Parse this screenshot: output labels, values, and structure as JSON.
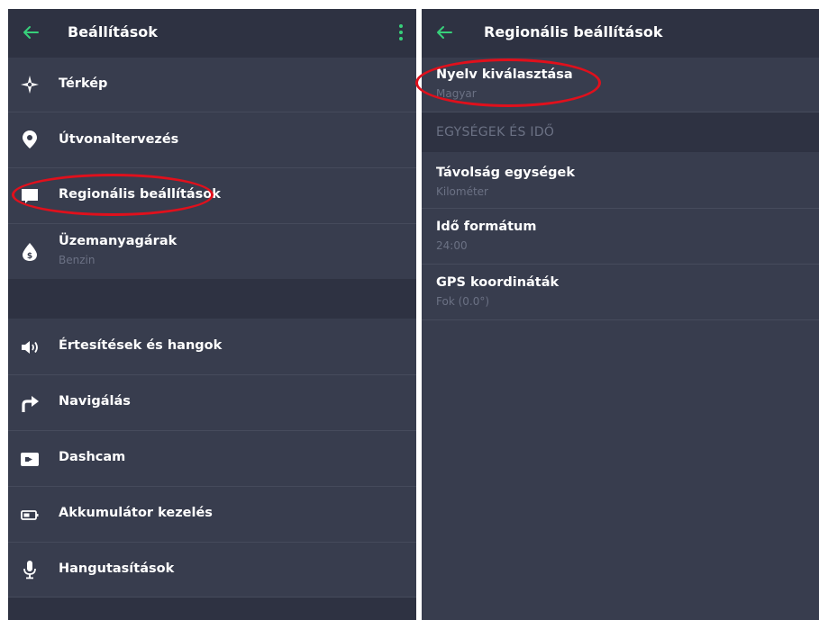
{
  "colors": {
    "accent": "#37d07a",
    "panel_bg": "#383d4e",
    "header_bg": "#2e3242",
    "highlight": "#e0101c"
  },
  "left": {
    "title": "Beállítások",
    "back_icon": "back-arrow-icon",
    "menu_icon": "more-vertical-icon",
    "items": [
      {
        "label": "Térkép",
        "icon": "compass-icon"
      },
      {
        "label": "Útvonaltervezés",
        "icon": "map-pin-icon"
      },
      {
        "label": "Regionális beállítások",
        "icon": "flag-icon"
      },
      {
        "label": "Üzemanyagárak",
        "sublabel": "Benzin",
        "icon": "fuel-drop-icon"
      },
      {
        "label": "Értesítések és hangok",
        "icon": "speaker-icon"
      },
      {
        "label": "Navigálás",
        "icon": "turn-right-icon"
      },
      {
        "label": "Dashcam",
        "icon": "camera-icon"
      },
      {
        "label": "Akkumulátor kezelés",
        "icon": "battery-icon"
      },
      {
        "label": "Hangutasítások",
        "icon": "microphone-icon"
      }
    ]
  },
  "right": {
    "title": "Regionális beállítások",
    "back_icon": "back-arrow-icon",
    "language": {
      "label": "Nyelv kiválasztása",
      "value": "Magyar"
    },
    "section_header": "EGYSÉGEK ÉS IDŐ",
    "items": [
      {
        "label": "Távolság egységek",
        "value": "Kilométer"
      },
      {
        "label": "Idő formátum",
        "value": "24:00"
      },
      {
        "label": "GPS koordináták",
        "value": "Fok (0.0°)"
      }
    ]
  }
}
